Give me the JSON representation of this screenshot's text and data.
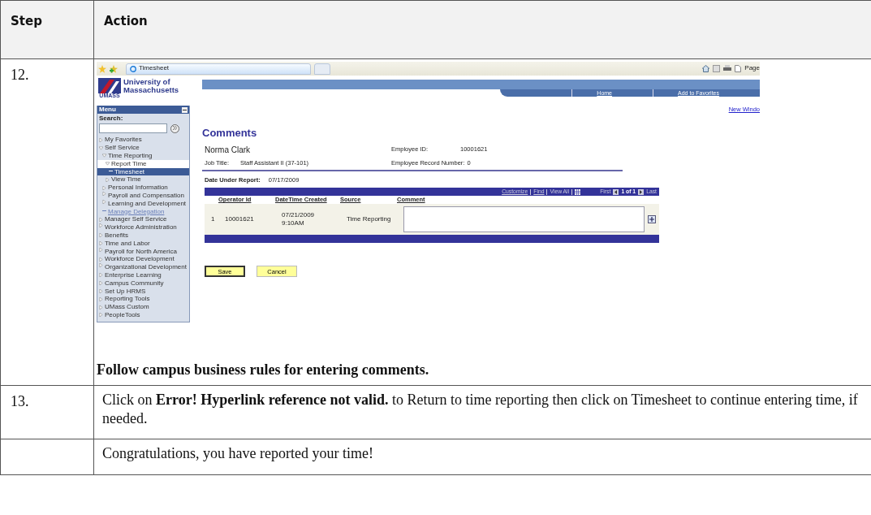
{
  "table": {
    "columns": [
      "Step",
      "Action"
    ],
    "rows": [
      {
        "step": "12.",
        "kind": "screenshot",
        "caption": "Follow campus business rules for entering comments."
      },
      {
        "step": "13.",
        "kind": "text",
        "text": "Click on **Error! Hyperlink reference not valid.** to Return to time reporting then click on Timesheet to continue entering time, if needed."
      },
      {
        "step": "",
        "kind": "text",
        "text": "Congratulations, you have reported your time!"
      }
    ]
  },
  "screenshot": {
    "browser": {
      "tab_title": "Timesheet",
      "toolbar_label": "Page"
    },
    "header": {
      "logo_text": "University of Massachusetts",
      "logo_mark": "UMASS",
      "nav_links": [
        "Home",
        "Add to Favorites"
      ]
    },
    "menu": {
      "title": "Menu",
      "search_label": "Search:",
      "items": [
        {
          "label": "My Favorites",
          "kind": "folder",
          "expanded": false,
          "selected": false
        },
        {
          "label": "Self Service",
          "kind": "folder",
          "expanded": true,
          "selected": false,
          "children": [
            {
              "label": "Time Reporting",
              "kind": "folder",
              "expanded": true,
              "selected": false,
              "children": [
                {
                  "label": "Report Time",
                  "kind": "folder",
                  "expanded": true,
                  "selected": false,
                  "children": [
                    {
                      "label": "Timesheet",
                      "kind": "link",
                      "selected": true
                    }
                  ]
                },
                {
                  "label": "View Time",
                  "kind": "folder",
                  "expanded": false,
                  "selected": false
                }
              ]
            },
            {
              "label": "Personal Information",
              "kind": "folder",
              "expanded": false,
              "selected": false
            },
            {
              "label": "Payroll and Compensation",
              "kind": "folder",
              "expanded": false,
              "selected": false
            },
            {
              "label": "Learning and Development",
              "kind": "folder",
              "expanded": false,
              "selected": false
            },
            {
              "label": "Manage Delegation",
              "kind": "link",
              "selected": false
            }
          ]
        },
        {
          "label": "Manager Self Service",
          "kind": "folder",
          "expanded": false,
          "selected": false
        },
        {
          "label": "Workforce Administration",
          "kind": "folder",
          "expanded": false,
          "selected": false
        },
        {
          "label": "Benefits",
          "kind": "folder",
          "expanded": false,
          "selected": false
        },
        {
          "label": "Time and Labor",
          "kind": "folder",
          "expanded": false,
          "selected": false
        },
        {
          "label": "Payroll for North America",
          "kind": "folder",
          "expanded": false,
          "selected": false
        },
        {
          "label": "Workforce Development",
          "kind": "folder",
          "expanded": false,
          "selected": false
        },
        {
          "label": "Organizational Development",
          "kind": "folder",
          "expanded": false,
          "selected": false
        },
        {
          "label": "Enterprise Learning",
          "kind": "folder",
          "expanded": false,
          "selected": false
        },
        {
          "label": "Campus Community",
          "kind": "folder",
          "expanded": false,
          "selected": false
        },
        {
          "label": "Set Up HRMS",
          "kind": "folder",
          "expanded": false,
          "selected": false
        },
        {
          "label": "Reporting Tools",
          "kind": "folder",
          "expanded": false,
          "selected": false
        },
        {
          "label": "UMass Custom",
          "kind": "folder",
          "expanded": false,
          "selected": false
        },
        {
          "label": "PeopleTools",
          "kind": "folder",
          "expanded": false,
          "selected": false
        }
      ]
    },
    "content": {
      "new_window_link": "New Windo",
      "title": "Comments",
      "employee_name": "Norma Clark",
      "fields": [
        {
          "label": "Job Title:",
          "value": "Staff Assistant II (37-101)"
        },
        {
          "label": "Employee ID:",
          "value": "10001621"
        },
        {
          "label": "Employee Record Number:",
          "value": "0"
        }
      ],
      "date_under_report": {
        "label": "Date Under Report:",
        "value": "07/17/2009"
      },
      "grid": {
        "links": [
          "Customize",
          "Find",
          "View All"
        ],
        "first": "First",
        "page": "1 of 1",
        "last": "Last",
        "columns": [
          "Operator Id",
          "DateTime Created",
          "Source",
          "Comment"
        ],
        "rows": [
          {
            "row_number": "1",
            "operator_id": "10001621",
            "created": "07/21/2009 9:10AM",
            "source": "Time Reporting"
          }
        ]
      },
      "buttons": [
        "Save",
        "Cancel"
      ]
    }
  }
}
